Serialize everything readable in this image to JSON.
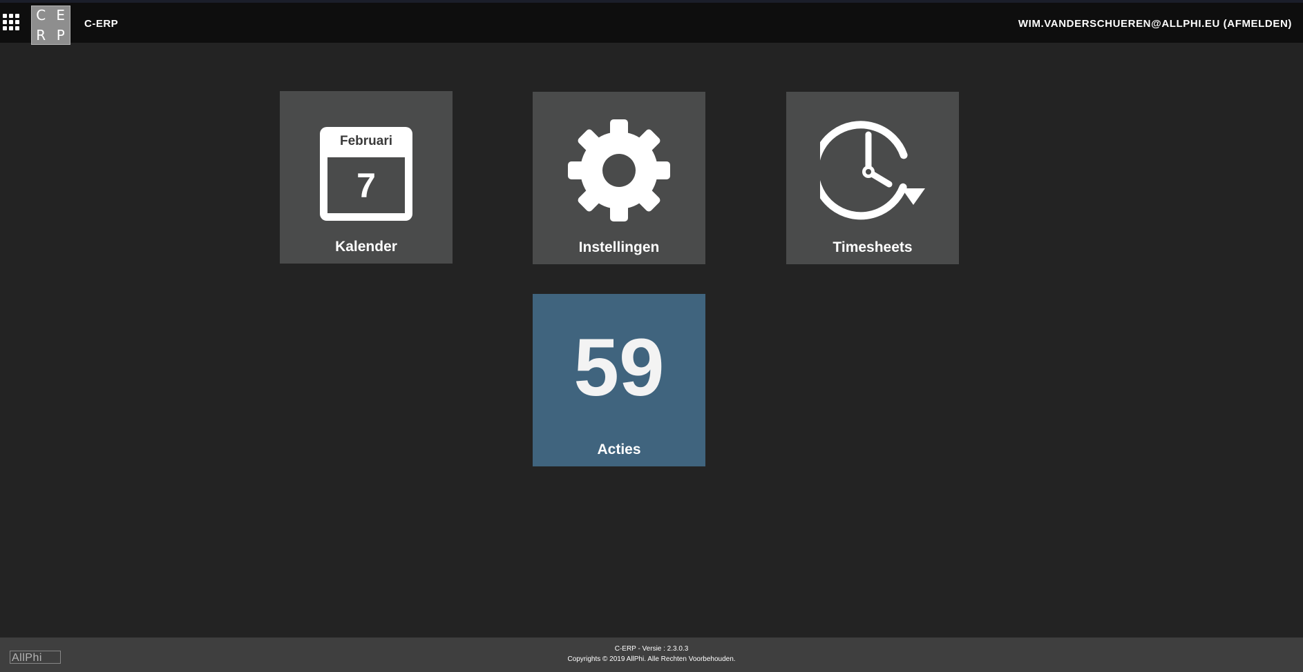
{
  "header": {
    "logo_letters": [
      "C",
      "E",
      "R",
      "P"
    ],
    "app_title": "C-ERP",
    "user_link": "WIM.VANDERSCHUEREN@ALLPHI.EU (AFMELDEN)",
    "apps_icon": "grid-icon"
  },
  "tiles": [
    {
      "label": "Kalender",
      "icon": "calendar-icon",
      "month": "Februari",
      "day": "7"
    },
    {
      "label": "Instellingen",
      "icon": "gear-icon"
    },
    {
      "label": "Timesheets",
      "icon": "clock-refresh-icon"
    },
    {
      "label": "Acties",
      "count": "59"
    }
  ],
  "colors": {
    "background": "#232323",
    "header": "#0e0e0e",
    "tile": "#4a4b4b",
    "tile_accent": "#40647e",
    "footer": "#3f3f3f"
  },
  "footer": {
    "brand": "AllPhi",
    "version": "C-ERP - Versie : 2.3.0.3",
    "copyright": "Copyrights © 2019 AllPhi. Alle Rechten Voorbehouden."
  }
}
